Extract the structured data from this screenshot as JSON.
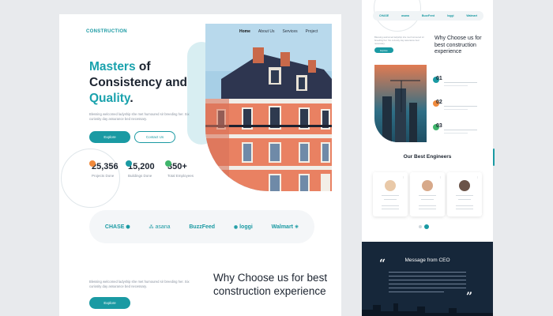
{
  "main": {
    "logo": "CONSTRUCTION",
    "nav": [
      "Home",
      "About Us",
      "Services",
      "Project"
    ],
    "hero": {
      "title_part1": "Masters",
      "title_part2": " of",
      "title_line2": "Consistency and",
      "title_part3": "Quality",
      "title_part4": ".",
      "description": "Blessing welcomed ladyship she met humoured sir breeding her. Six curiosity day assurance bed necessary.",
      "primary_button": "Explore",
      "secondary_button": "Contact Us"
    },
    "stats": [
      {
        "value": "25,356",
        "label": "Projects Done"
      },
      {
        "value": "15,200",
        "label": "Buildings Done"
      },
      {
        "value": "350+",
        "label": "Total Employees"
      }
    ],
    "brands": [
      {
        "name": "CHASE",
        "glyph": "⬢"
      },
      {
        "name": "asana",
        "glyph": "⁂"
      },
      {
        "name": "BuzzFeed",
        "glyph": ""
      },
      {
        "name": "loggi",
        "glyph": "◉"
      },
      {
        "name": "Walmart",
        "glyph": "✳"
      }
    ],
    "why": {
      "description": "Blessing welcomed ladyship she met humoured sir breeding her. Six curiosity day assurance bed necessary.",
      "button": "Explore",
      "title": "Why Choose us for best construction experience"
    }
  },
  "mobile": {
    "brands": [
      "CHASE",
      "asana",
      "BuzzFeed",
      "loggi",
      "Walmart"
    ],
    "why_title": "Why Choose us for best construction experience",
    "features": [
      "01",
      "02",
      "03"
    ],
    "engineers_title": "Our Best Engineers",
    "ceo_title": "Message from CEO"
  },
  "colors": {
    "accent": "#1a9aa3",
    "dark": "#1c2430",
    "ceo_bg": "#16273a",
    "orange": "#f08a3c",
    "green": "#3fb56b"
  }
}
